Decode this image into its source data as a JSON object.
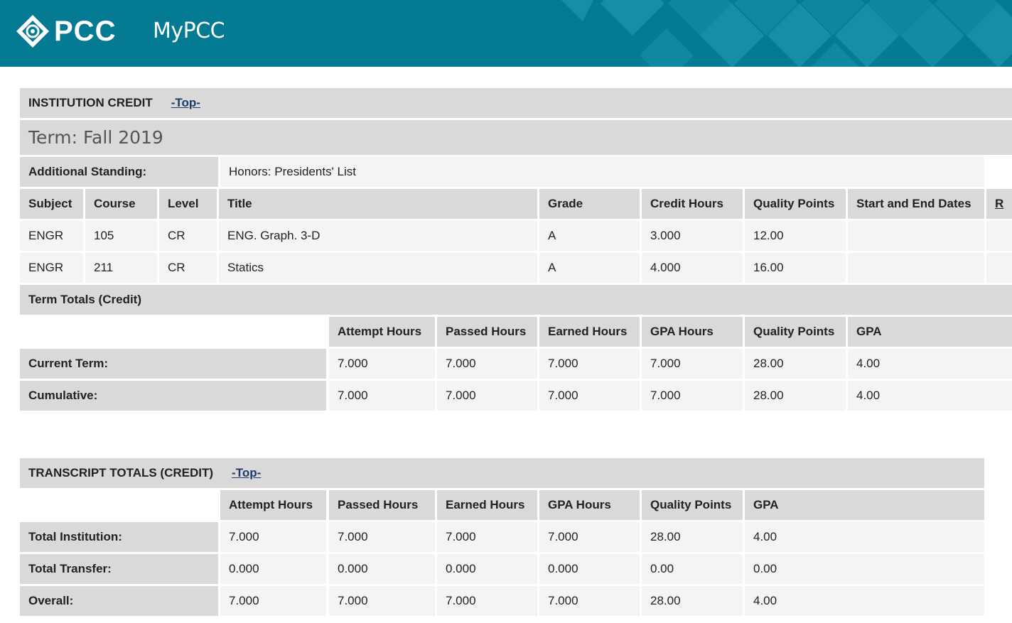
{
  "header": {
    "logo_text": "PCC",
    "app_title": "MyPCC"
  },
  "institution": {
    "section_title": "INSTITUTION CREDIT",
    "top_link": "-Top-",
    "term": "Term: Fall 2019",
    "standing_label": "Additional Standing:",
    "standing_value": "Honors: Presidents' List",
    "columns": [
      "Subject",
      "Course",
      "Level",
      "Title",
      "Grade",
      "Credit Hours",
      "Quality Points",
      "Start and End Dates",
      "R"
    ],
    "courses": [
      {
        "subject": "ENGR",
        "course": "105",
        "level": "CR",
        "title": "ENG. Graph. 3-D",
        "grade": "A",
        "credit_hours": "3.000",
        "quality_points": "12.00",
        "dates": ""
      },
      {
        "subject": "ENGR",
        "course": "211",
        "level": "CR",
        "title": "Statics",
        "grade": "A",
        "credit_hours": "4.000",
        "quality_points": "16.00",
        "dates": ""
      }
    ],
    "term_totals_title": "Term Totals (Credit)",
    "totals_columns": [
      "Attempt Hours",
      "Passed Hours",
      "Earned Hours",
      "GPA Hours",
      "Quality Points",
      "GPA"
    ],
    "totals_rows": [
      {
        "label": "Current Term:",
        "values": [
          "7.000",
          "7.000",
          "7.000",
          "7.000",
          "28.00",
          "4.00"
        ]
      },
      {
        "label": "Cumulative:",
        "values": [
          "7.000",
          "7.000",
          "7.000",
          "7.000",
          "28.00",
          "4.00"
        ]
      }
    ]
  },
  "transcript": {
    "section_title": "TRANSCRIPT TOTALS (CREDIT)",
    "top_link": "-Top-",
    "columns": [
      "Attempt Hours",
      "Passed Hours",
      "Earned Hours",
      "GPA Hours",
      "Quality Points",
      "GPA"
    ],
    "rows": [
      {
        "label": "Total Institution:",
        "values": [
          "7.000",
          "7.000",
          "7.000",
          "7.000",
          "28.00",
          "4.00"
        ]
      },
      {
        "label": "Total Transfer:",
        "values": [
          "0.000",
          "0.000",
          "0.000",
          "0.000",
          "0.00",
          "0.00"
        ]
      },
      {
        "label": "Overall:",
        "values": [
          "7.000",
          "7.000",
          "7.000",
          "7.000",
          "28.00",
          "4.00"
        ]
      }
    ]
  },
  "colors": {
    "header_bg": "#057a93",
    "header_cell": "#d9d9d9",
    "row_cell": "#f4f4f4",
    "link": "#1f3a6b"
  },
  "icons": {
    "logo": "pcc-swirl-diamond-icon"
  }
}
